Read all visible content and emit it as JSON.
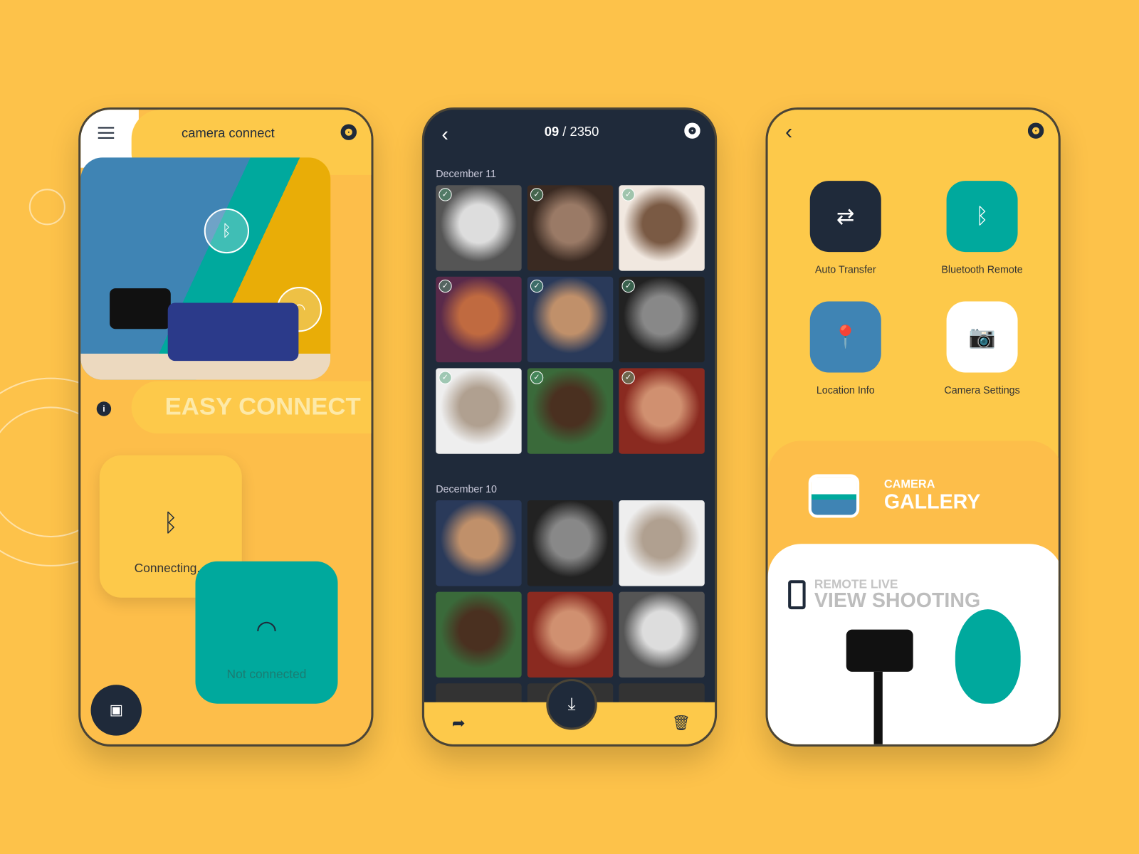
{
  "screen1": {
    "title": "camera connect",
    "heading": "EASY CONNECT",
    "bluetooth_status": "Connecting...",
    "wifi_status": "Not connected",
    "icons": {
      "menu": "hamburger-icon",
      "settings": "gear-icon",
      "info": "info-icon",
      "bluetooth": "bluetooth-icon",
      "wifi": "wifi-icon",
      "gallery": "image-icon"
    }
  },
  "screen2": {
    "counter_current": "09",
    "counter_sep": " / 2350",
    "sections": [
      {
        "date": "December 11",
        "selected": [
          true,
          true,
          true,
          true,
          true,
          true,
          true,
          true,
          true
        ]
      },
      {
        "date": "December 10",
        "selected": [
          false,
          false,
          false,
          false,
          false,
          false
        ]
      }
    ],
    "icons": {
      "back": "chevron-left-icon",
      "settings": "gear-icon",
      "share": "share-icon",
      "download": "download-icon",
      "delete": "trash-icon"
    }
  },
  "screen3": {
    "tiles": [
      {
        "label": "Auto Transfer",
        "icon": "⇄",
        "color": "#1f2a3a"
      },
      {
        "label": "Bluetooth Remote",
        "icon": "ᛒ",
        "color": "#00a99d"
      },
      {
        "label": "Location Info",
        "icon": "📍",
        "color": "#3f84b4"
      },
      {
        "label": "Camera Settings",
        "icon": "📷",
        "color": "#ffffff"
      }
    ],
    "gallery_small": "CAMERA",
    "gallery_big": "GALLERY",
    "remote_small": "REMOTE LIVE",
    "remote_big": "VIEW SHOOTING"
  },
  "colors": {
    "background": "#fdc24a",
    "dark": "#1f2a3a",
    "teal": "#00a99d",
    "blue": "#3f84b4"
  }
}
